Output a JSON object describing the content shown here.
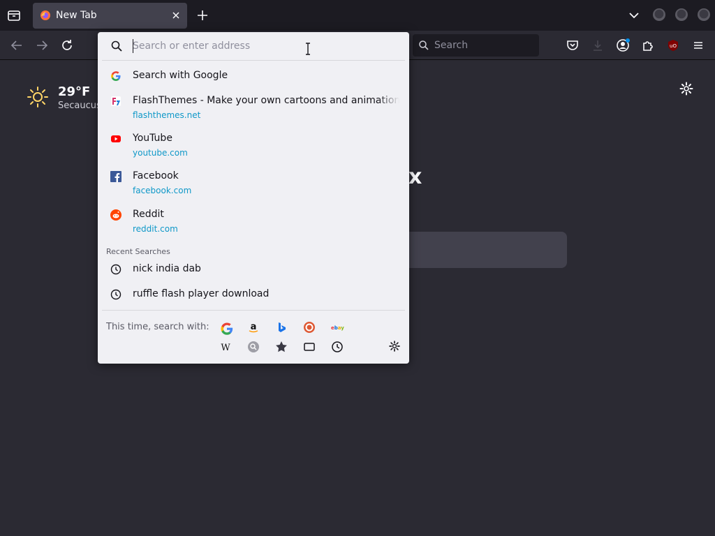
{
  "tabs": [
    {
      "title": "New Tab",
      "active": true
    }
  ],
  "toolbar": {
    "search_placeholder": "Search"
  },
  "newtab": {
    "weather": {
      "temperature": "29°F",
      "location": "Secaucus"
    },
    "brand_fragment": "x"
  },
  "urlbar": {
    "placeholder": "Search or enter address",
    "value": "",
    "results": [
      {
        "icon": "google-icon",
        "title": "Search with Google",
        "url": ""
      },
      {
        "icon": "flashthemes-icon",
        "title": "FlashThemes - Make your own cartoons and animations easily",
        "url": "flashthemes.net"
      },
      {
        "icon": "youtube-icon",
        "title": "YouTube",
        "url": "youtube.com"
      },
      {
        "icon": "facebook-icon",
        "title": "Facebook",
        "url": "facebook.com"
      },
      {
        "icon": "reddit-icon",
        "title": "Reddit",
        "url": "reddit.com"
      }
    ],
    "recent_searches_label": "Recent Searches",
    "recent_searches": [
      {
        "icon": "history-icon",
        "text": "nick india dab"
      },
      {
        "icon": "history-icon",
        "text": "ruffle flash player download"
      }
    ],
    "search_with_label": "This time, search with:",
    "one_off_engines": [
      "google-icon",
      "amazon-icon",
      "bing-icon",
      "duckduckgo-icon",
      "ebay-icon",
      "wikipedia-icon",
      "search-engine-icon",
      "bookmarks-icon",
      "tabs-icon",
      "history-icon"
    ]
  },
  "colors": {
    "toolbar_bg": "#2b2a33",
    "tabstrip_bg": "#1c1b22",
    "dropdown_bg": "#f0f0f4",
    "url_color": "#0f98c8"
  }
}
